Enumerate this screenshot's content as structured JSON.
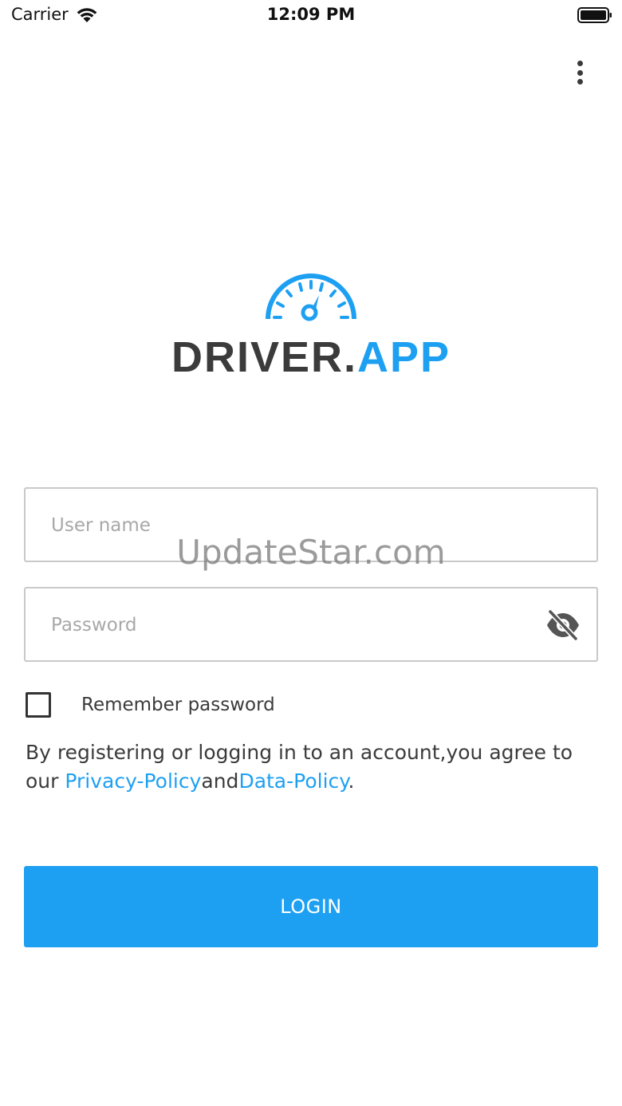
{
  "status_bar": {
    "carrier": "Carrier",
    "time": "12:09 PM"
  },
  "header": {
    "menu_icon": "more-vertical-icon"
  },
  "logo": {
    "icon": "speedometer-icon",
    "text_dark": "DRIVER.",
    "text_accent": "APP"
  },
  "form": {
    "username_placeholder": "User name",
    "username_value": "",
    "password_placeholder": "Password",
    "password_value": "",
    "password_toggle_icon": "eye-off-icon",
    "remember_label": "Remember password",
    "remember_checked": false
  },
  "watermark": "UpdateStar.com",
  "terms": {
    "prefix": "By registering or logging in to an account,you agree to our ",
    "privacy_link": "Privacy-Policy",
    "joiner": "and",
    "data_link": "Data-Policy",
    "suffix": "."
  },
  "login_button": "LOGIN",
  "colors": {
    "accent": "#1ea0f2",
    "text": "#3b3b3b",
    "border": "#c9c9c9"
  }
}
